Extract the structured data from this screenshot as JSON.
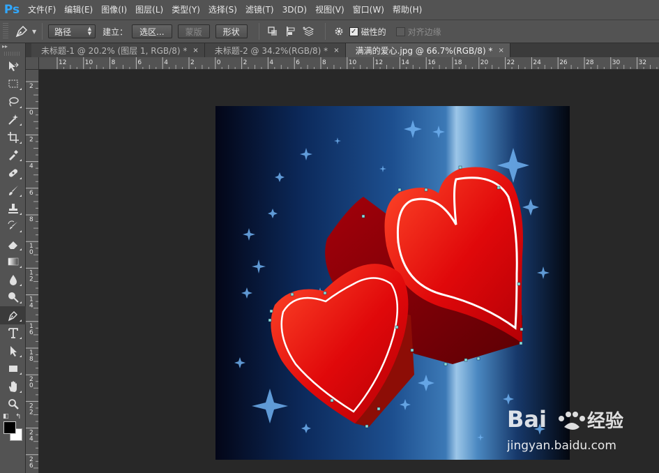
{
  "app": {
    "logo": "Ps"
  },
  "menu": [
    "文件(F)",
    "编辑(E)",
    "图像(I)",
    "图层(L)",
    "类型(Y)",
    "选择(S)",
    "滤镜(T)",
    "3D(D)",
    "视图(V)",
    "窗口(W)",
    "帮助(H)"
  ],
  "options": {
    "mode_value": "路径",
    "make_label": "建立：",
    "selection_button": "选区...",
    "mask_button": "蒙版",
    "shape_button": "形状",
    "magnetic_label": "磁性的",
    "magnetic_checked": true,
    "align_edges_label": "对齐边缘",
    "align_edges_checked": false
  },
  "tabs": [
    {
      "title": "未标题-1 @ 20.2% (图层 1, RGB/8) *",
      "close": "×",
      "active": false
    },
    {
      "title": "未标题-2 @ 34.2%(RGB/8) *",
      "close": "×",
      "active": false
    },
    {
      "title": "满满的爱心.jpg @ 66.7%(RGB/8) *",
      "close": "×",
      "active": true
    }
  ],
  "ruler": {
    "top_labels": [
      "12",
      "10",
      "8",
      "6",
      "4",
      "2",
      "0",
      "2",
      "4",
      "6",
      "8",
      "10",
      "12",
      "14",
      "16",
      "18",
      "20",
      "22",
      "24",
      "26",
      "28",
      "30",
      "32"
    ],
    "left_labels": [
      "2",
      "0",
      "2",
      "4",
      "6",
      "8",
      "10",
      "12",
      "14",
      "16",
      "18",
      "20",
      "22",
      "24",
      "26"
    ]
  },
  "tools": [
    {
      "name": "move-tool",
      "icon": "move-icon"
    },
    {
      "name": "marquee-tool",
      "icon": "rect-marquee-icon"
    },
    {
      "name": "lasso-tool",
      "icon": "lasso-icon"
    },
    {
      "name": "magic-wand-tool",
      "icon": "magic-wand-icon"
    },
    {
      "name": "crop-tool",
      "icon": "crop-icon"
    },
    {
      "name": "eyedropper-tool",
      "icon": "eyedropper-icon"
    },
    {
      "name": "healing-brush-tool",
      "icon": "bandage-icon"
    },
    {
      "name": "brush-tool",
      "icon": "brush-icon"
    },
    {
      "name": "clone-stamp-tool",
      "icon": "stamp-icon"
    },
    {
      "name": "history-brush-tool",
      "icon": "history-brush-icon"
    },
    {
      "name": "eraser-tool",
      "icon": "eraser-icon"
    },
    {
      "name": "gradient-tool",
      "icon": "gradient-icon"
    },
    {
      "name": "blur-tool",
      "icon": "drop-icon"
    },
    {
      "name": "dodge-tool",
      "icon": "dodge-icon"
    },
    {
      "name": "pen-tool",
      "icon": "pen-icon",
      "active": true
    },
    {
      "name": "type-tool",
      "icon": "type-icon"
    },
    {
      "name": "path-selection-tool",
      "icon": "arrow-icon"
    },
    {
      "name": "shape-tool",
      "icon": "rectangle-icon"
    },
    {
      "name": "hand-tool",
      "icon": "hand-icon"
    },
    {
      "name": "zoom-tool",
      "icon": "zoom-icon"
    }
  ],
  "colors": {
    "foreground": "#000000",
    "background": "#ffffff"
  },
  "watermark": {
    "brand": "Baidu经验",
    "url": "jingyan.baidu.com"
  }
}
